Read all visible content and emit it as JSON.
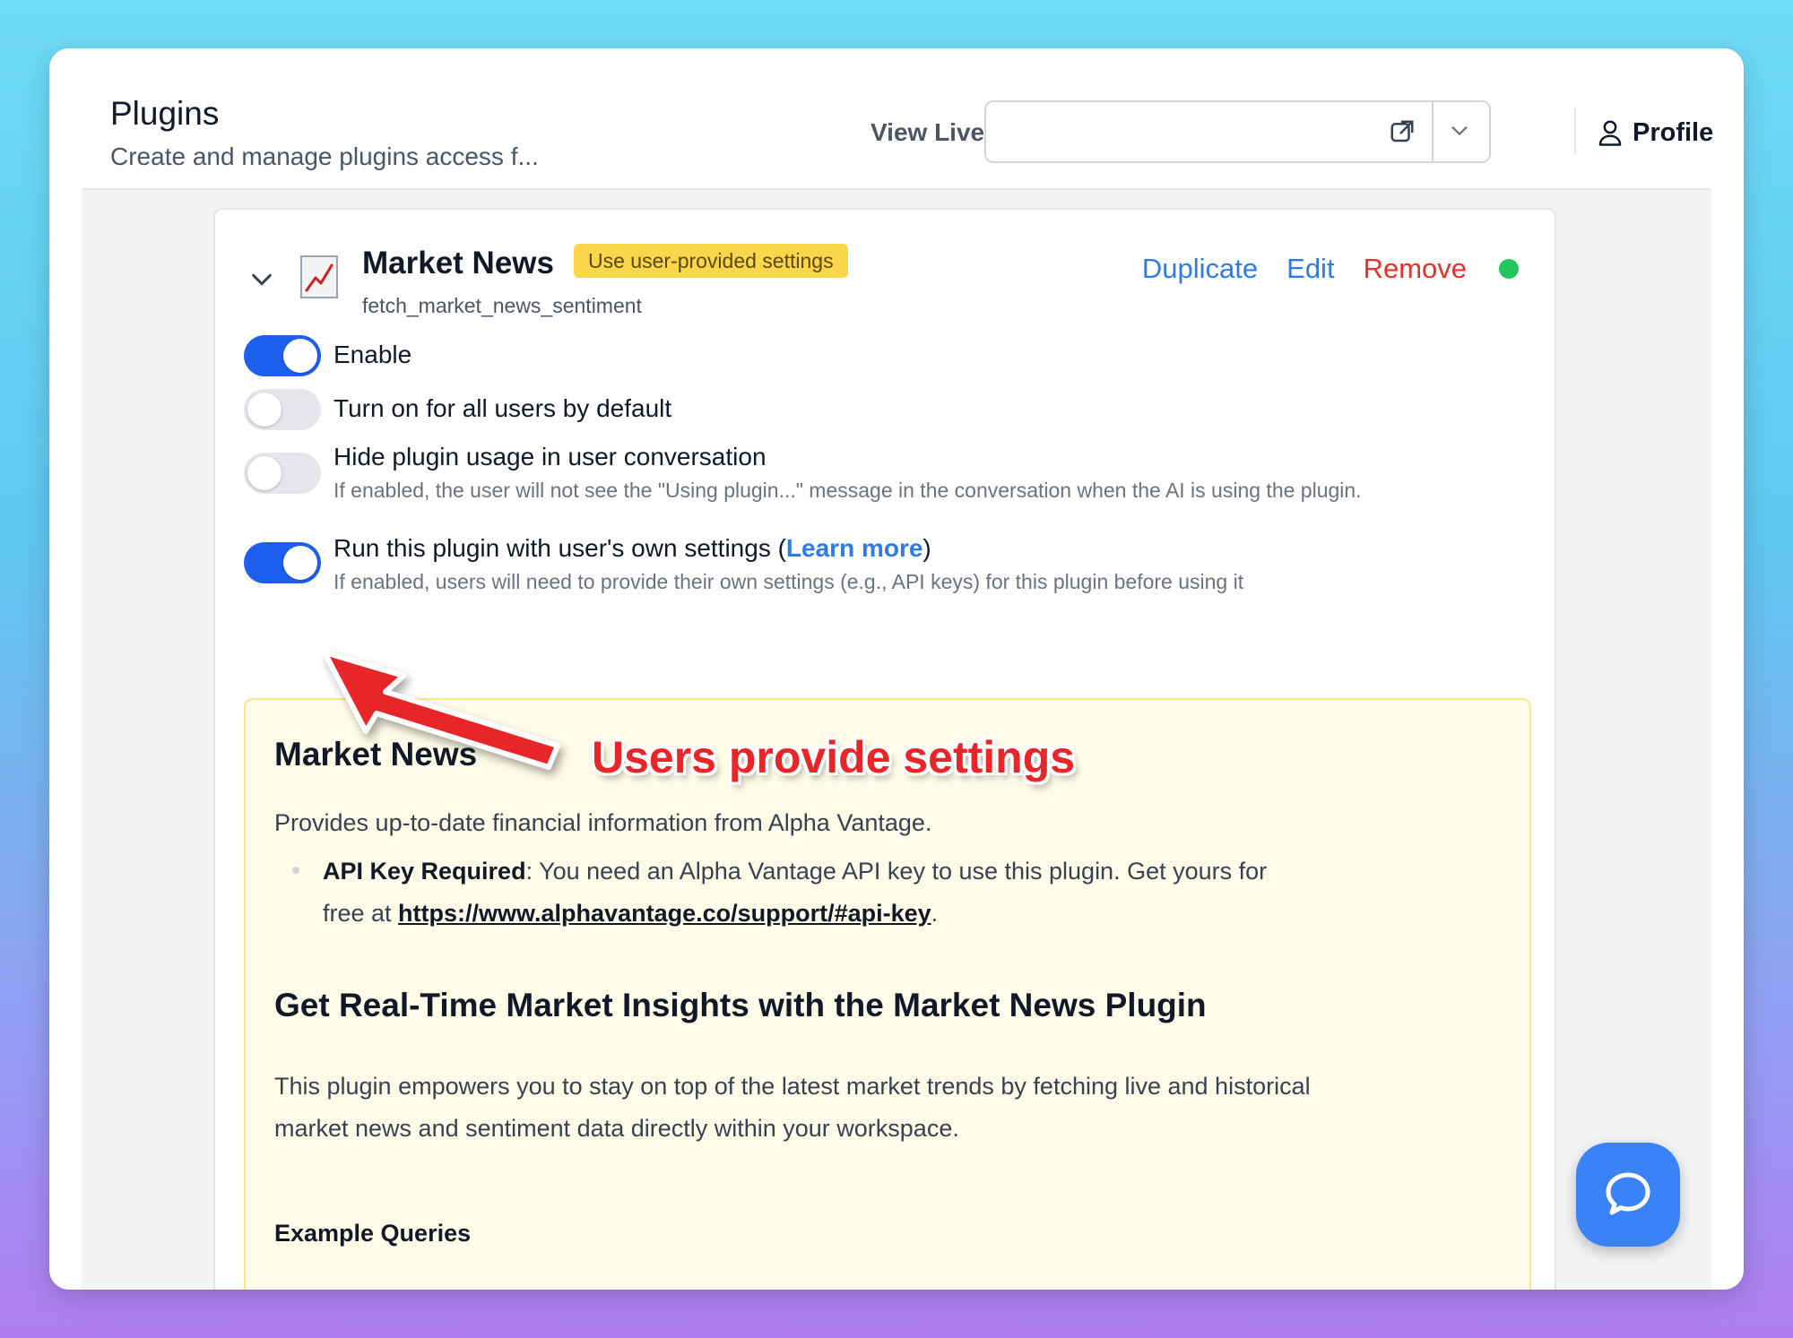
{
  "header": {
    "title": "Plugins",
    "subtitle": "Create and manage plugins access f...",
    "view_live_label": "View Live:",
    "view_live_value": "",
    "profile_label": "Profile"
  },
  "plugin": {
    "name": "Market News",
    "badge": "Use user-provided settings",
    "function_name": "fetch_market_news_sentiment",
    "actions": {
      "duplicate": "Duplicate",
      "edit": "Edit",
      "remove": "Remove"
    },
    "status_color": "#22c55e",
    "options": [
      {
        "label": "Enable",
        "on": true
      },
      {
        "label": "Turn on for all users by default",
        "on": false
      },
      {
        "label": "Hide plugin usage in user conversation",
        "on": false,
        "description": "If enabled, the user will not see the \"Using plugin...\" message in the conversation when the AI is using the plugin."
      },
      {
        "label_prefix": "Run this plugin with user's own settings (",
        "link": "Learn more",
        "label_suffix": ")",
        "on": true,
        "description": "If enabled, users will need to provide their own settings (e.g., API keys) for this plugin before using it"
      }
    ]
  },
  "readme": {
    "heading": "Market News",
    "intro": "Provides up-to-date financial information from Alpha Vantage.",
    "bullet_bold": "API Key Required",
    "bullet_text": ": You need an Alpha Vantage API key to use this plugin. Get yours for free at ",
    "bullet_url": "https://www.alphavantage.co/support/#api-key",
    "bullet_end": ".",
    "subheading": "Get Real-Time Market Insights with the Market News Plugin",
    "paragraph": "This plugin empowers you to stay on top of the latest market trends by fetching live and historical market news and sentiment data directly within your workspace.",
    "section": "Example Queries"
  },
  "annotation": {
    "text": "Users provide settings",
    "color": "#e8262a"
  },
  "colors": {
    "accent": "#1f5ff0",
    "link": "#2f7be6",
    "danger": "#e5312a",
    "badge": "#fbd54a"
  }
}
